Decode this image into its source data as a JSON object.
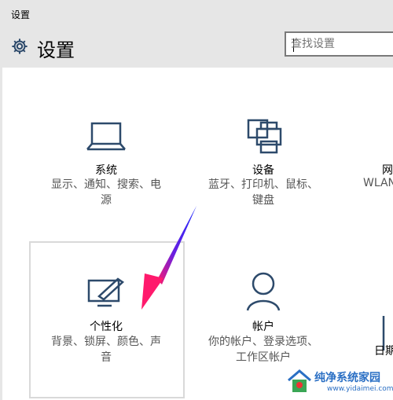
{
  "window": {
    "title": "设置"
  },
  "header": {
    "title": "设置",
    "search_placeholder": "查找设置"
  },
  "tiles": [
    {
      "name": "系统",
      "desc_line1": "显示、通知、搜索、电",
      "desc_line2": "源",
      "icon": "laptop-icon"
    },
    {
      "name": "设备",
      "desc_line1": "蓝牙、打印机、鼠标、",
      "desc_line2": "键盘",
      "icon": "printer-icon"
    },
    {
      "name": "网",
      "desc_line1": "WLAN",
      "icon": "network-icon"
    },
    {
      "name": "个性化",
      "desc_line1": "背景、锁屏、颜色、声",
      "desc_line2": "音",
      "icon": "personalization-icon"
    },
    {
      "name": "帐户",
      "desc_line1": "你的帐户、登录选项、",
      "desc_line2": "工作区帐户",
      "icon": "person-icon"
    },
    {
      "name": "日期",
      "icon": "time-language-icon"
    }
  ],
  "watermark": {
    "name": "纯净系统家园",
    "url": "www.yidaimei.com"
  },
  "colors": {
    "chrome": "#e6e6e6",
    "icon": "#2d4a6b",
    "arrow": "#ff1a6c"
  }
}
